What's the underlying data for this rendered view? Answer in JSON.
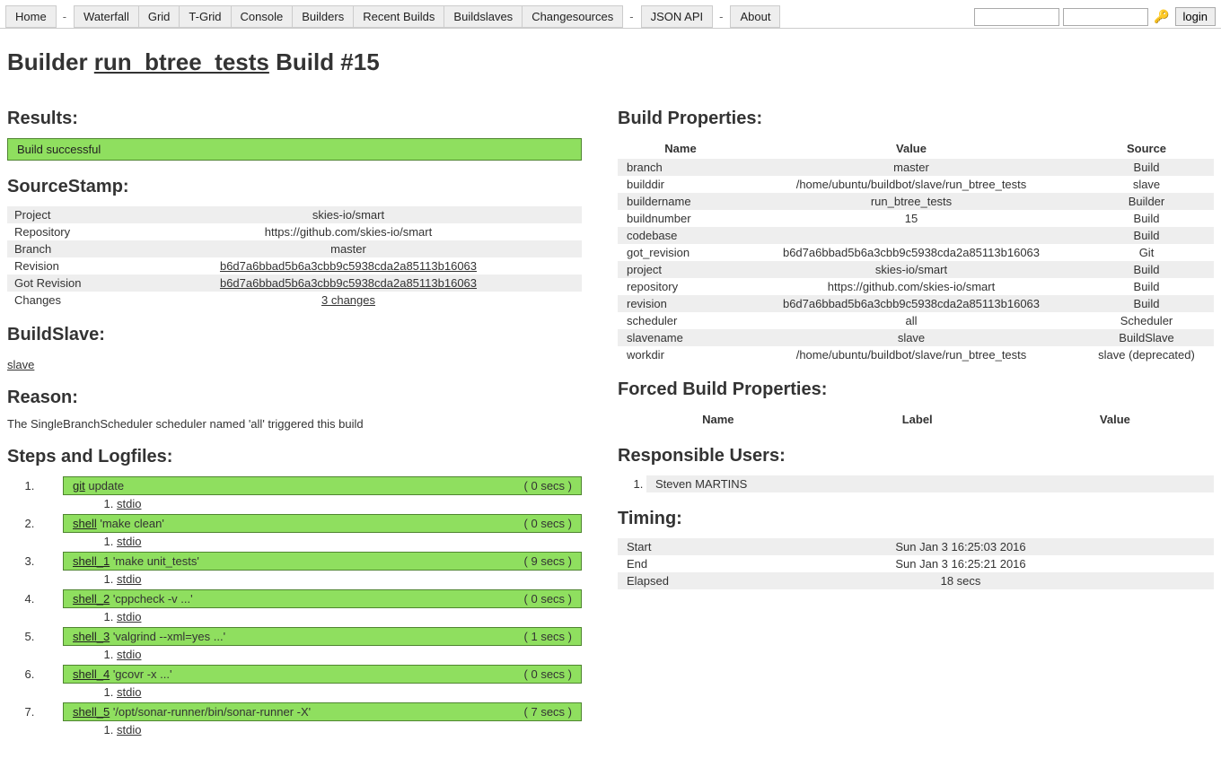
{
  "nav": {
    "home": "Home",
    "waterfall": "Waterfall",
    "grid": "Grid",
    "tgrid": "T-Grid",
    "console": "Console",
    "builders": "Builders",
    "recent_builds": "Recent Builds",
    "buildslaves": "Buildslaves",
    "changesources": "Changesources",
    "json_api": "JSON API",
    "about": "About"
  },
  "login_button": "login",
  "heading": {
    "prefix": "Builder ",
    "builder_name": "run_btree_tests",
    "suffix": " Build #15"
  },
  "results": {
    "heading": "Results:",
    "text": "Build successful"
  },
  "sourcestamp": {
    "heading": "SourceStamp:",
    "rows": [
      {
        "label": "Project",
        "value": "skies-io/smart",
        "link": false
      },
      {
        "label": "Repository",
        "value": "https://github.com/skies-io/smart",
        "link": false
      },
      {
        "label": "Branch",
        "value": "master",
        "link": false
      },
      {
        "label": "Revision",
        "value": "b6d7a6bbad5b6a3cbb9c5938cda2a85113b16063",
        "link": true
      },
      {
        "label": "Got Revision",
        "value": "b6d7a6bbad5b6a3cbb9c5938cda2a85113b16063",
        "link": true
      },
      {
        "label": "Changes",
        "value": "3 changes",
        "link": true
      }
    ]
  },
  "buildslave": {
    "heading": "BuildSlave:",
    "link": "slave"
  },
  "reason": {
    "heading": "Reason:",
    "text": "The SingleBranchScheduler scheduler named 'all' triggered this build"
  },
  "steps_heading": "Steps and Logfiles:",
  "steps": [
    {
      "name": "git",
      "desc": " update",
      "time": "( 0 secs )",
      "log": "stdio"
    },
    {
      "name": "shell",
      "desc": " 'make clean'",
      "time": "( 0 secs )",
      "log": "stdio"
    },
    {
      "name": "shell_1",
      "desc": " 'make unit_tests'",
      "time": "( 9 secs )",
      "log": "stdio"
    },
    {
      "name": "shell_2",
      "desc": " 'cppcheck -v ...'",
      "time": "( 0 secs )",
      "log": "stdio"
    },
    {
      "name": "shell_3",
      "desc": " 'valgrind --xml=yes ...'",
      "time": "( 1 secs )",
      "log": "stdio"
    },
    {
      "name": "shell_4",
      "desc": " 'gcovr -x ...'",
      "time": "( 0 secs )",
      "log": "stdio"
    },
    {
      "name": "shell_5",
      "desc": " '/opt/sonar-runner/bin/sonar-runner -X'",
      "time": "( 7 secs )",
      "log": "stdio"
    }
  ],
  "build_properties": {
    "heading": "Build Properties:",
    "headers": {
      "name": "Name",
      "value": "Value",
      "source": "Source"
    },
    "rows": [
      {
        "name": "branch",
        "value": "master",
        "source": "Build"
      },
      {
        "name": "builddir",
        "value": "/home/ubuntu/buildbot/slave/run_btree_tests",
        "source": "slave"
      },
      {
        "name": "buildername",
        "value": "run_btree_tests",
        "source": "Builder"
      },
      {
        "name": "buildnumber",
        "value": "15",
        "source": "Build"
      },
      {
        "name": "codebase",
        "value": "",
        "source": "Build"
      },
      {
        "name": "got_revision",
        "value": "b6d7a6bbad5b6a3cbb9c5938cda2a85113b16063",
        "source": "Git"
      },
      {
        "name": "project",
        "value": "skies-io/smart",
        "source": "Build"
      },
      {
        "name": "repository",
        "value": "https://github.com/skies-io/smart",
        "source": "Build"
      },
      {
        "name": "revision",
        "value": "b6d7a6bbad5b6a3cbb9c5938cda2a85113b16063",
        "source": "Build"
      },
      {
        "name": "scheduler",
        "value": "all",
        "source": "Scheduler"
      },
      {
        "name": "slavename",
        "value": "slave",
        "source": "BuildSlave"
      },
      {
        "name": "workdir",
        "value": "/home/ubuntu/buildbot/slave/run_btree_tests",
        "source": "slave (deprecated)"
      }
    ]
  },
  "forced": {
    "heading": "Forced Build Properties:",
    "headers": {
      "name": "Name",
      "label": "Label",
      "value": "Value"
    }
  },
  "responsible": {
    "heading": "Responsible Users:",
    "users": [
      "Steven MARTINS"
    ]
  },
  "timing": {
    "heading": "Timing:",
    "rows": [
      {
        "label": "Start",
        "value": "Sun Jan 3 16:25:03 2016"
      },
      {
        "label": "End",
        "value": "Sun Jan 3 16:25:21 2016"
      },
      {
        "label": "Elapsed",
        "value": "18 secs"
      }
    ]
  }
}
